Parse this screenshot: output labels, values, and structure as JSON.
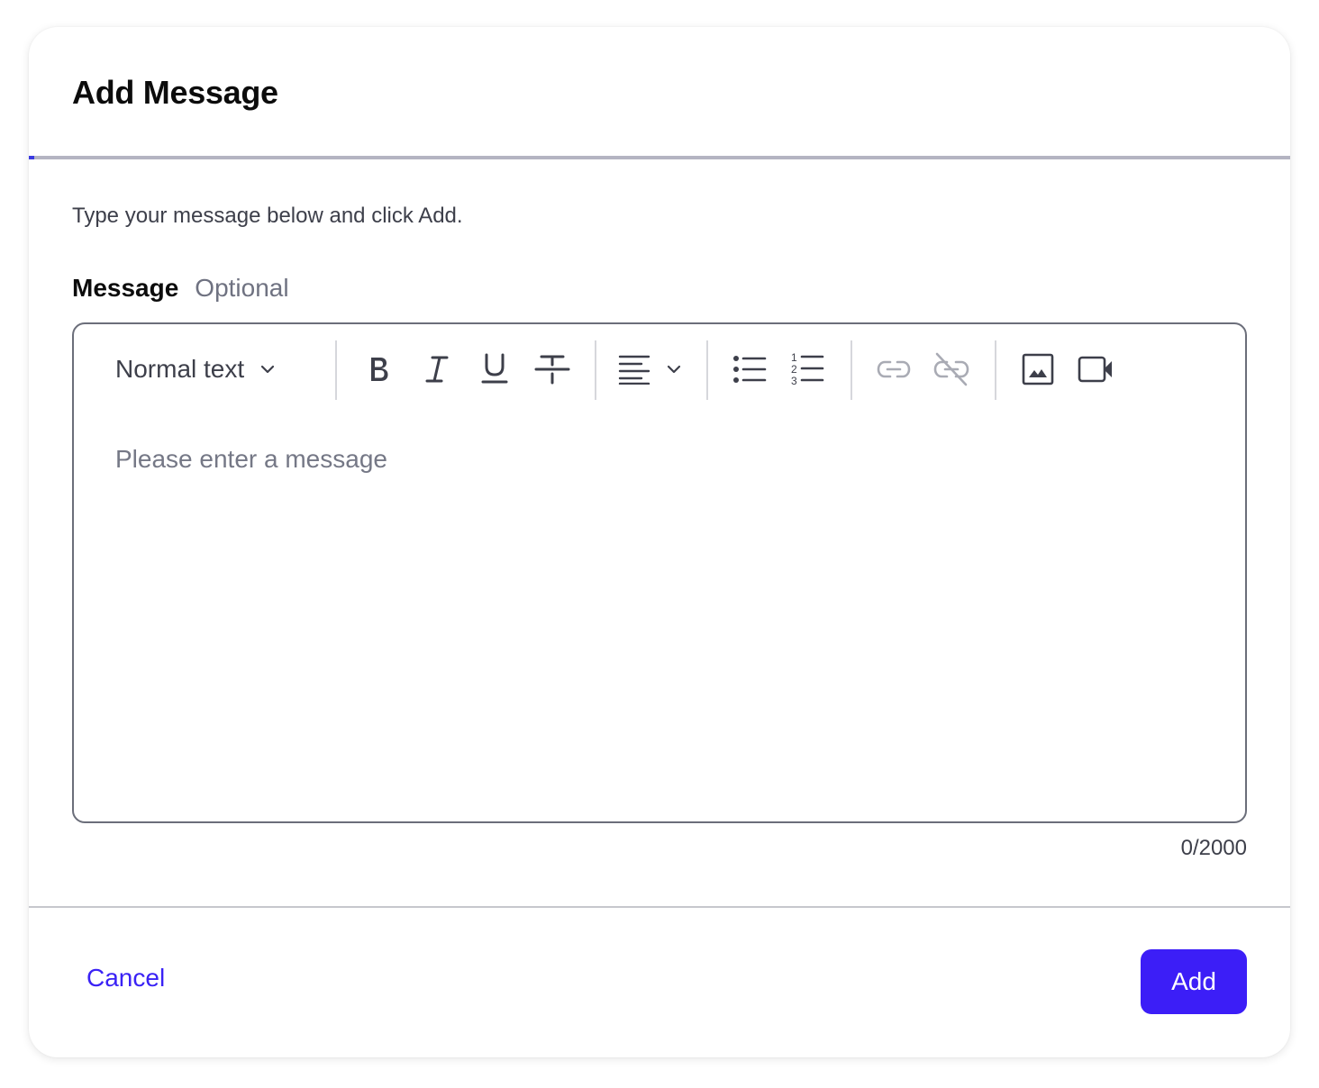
{
  "dialog": {
    "title": "Add Message",
    "description": "Type your message below and click Add."
  },
  "field": {
    "label": "Message",
    "optional": "Optional",
    "placeholder": "Please enter a message",
    "counter": "0/2000"
  },
  "toolbar": {
    "block_type": "Normal text",
    "buttons": [
      "bold-icon",
      "italic-icon",
      "underline-icon",
      "strikethrough-icon",
      "align-left-icon",
      "bullet-list-icon",
      "numbered-list-icon",
      "link-icon",
      "unlink-icon",
      "image-icon",
      "video-icon"
    ]
  },
  "footer": {
    "cancel_label": "Cancel",
    "add_label": "Add"
  },
  "colors": {
    "accent": "#3c1ef7",
    "link": "#3a22f5",
    "text": "#3d3f4a",
    "muted": "#6f7281",
    "disabled_icon": "#a9abb4"
  }
}
